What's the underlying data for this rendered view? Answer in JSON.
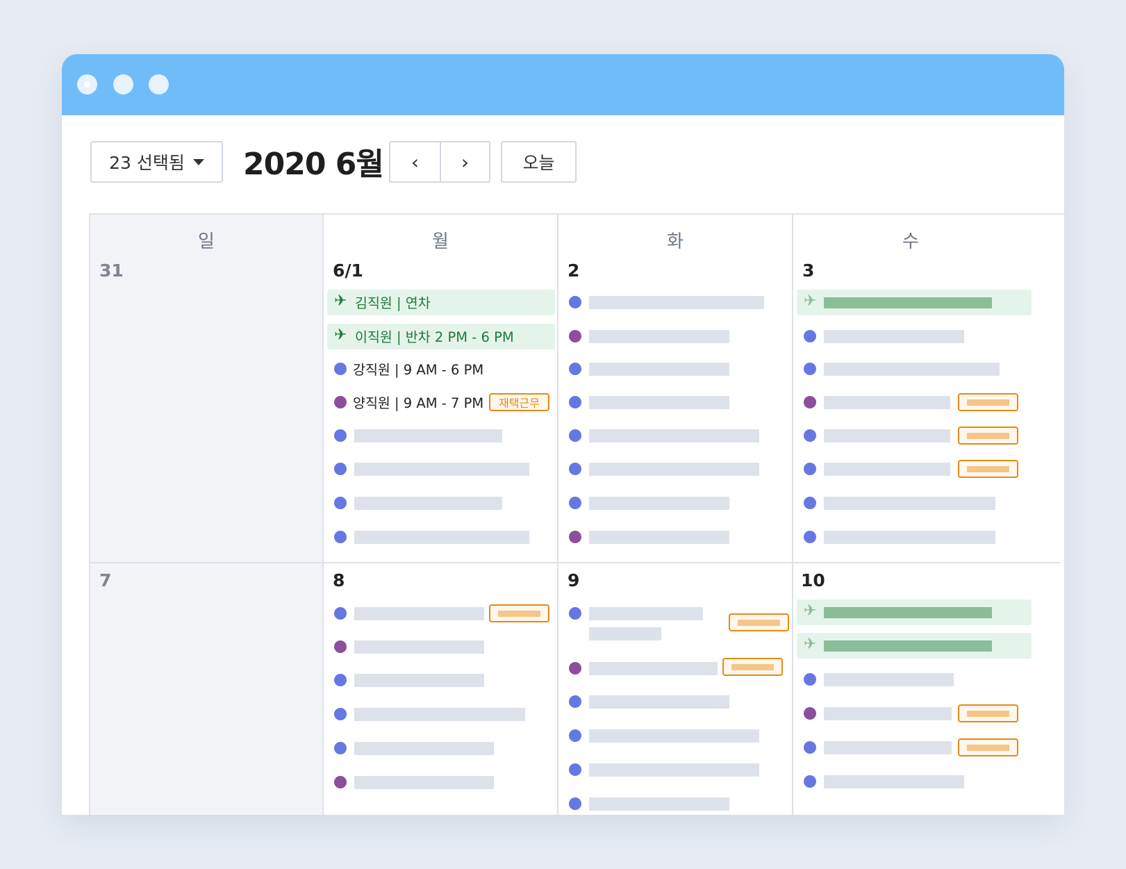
{
  "toolbar": {
    "filter_label": "23 선택됨",
    "month_title": "2020 6월",
    "prev_glyph": "‹",
    "next_glyph": "›",
    "today_label": "오늘"
  },
  "weekdays": [
    "일",
    "월",
    "화",
    "수"
  ],
  "week1": {
    "dates": [
      "31",
      "6/1",
      "2",
      "3"
    ],
    "mon_events": {
      "leave1": "김직원 | 연차",
      "leave2": "이직원 | 반차  2 PM - 6 PM",
      "event3": "강직원 | 9 AM - 6 PM",
      "event4": "양직원 | 9 AM - 7 PM",
      "event4_tag": "재택근무"
    }
  },
  "week2": {
    "dates": [
      "7",
      "8",
      "9",
      "10"
    ]
  },
  "colors": {
    "titlebar": "#70bcf9",
    "event_blue": "#6677e2",
    "event_purple": "#8c4f9b",
    "leave_green": "#1e7a3c",
    "remote_tag_orange": "#e38a16"
  }
}
